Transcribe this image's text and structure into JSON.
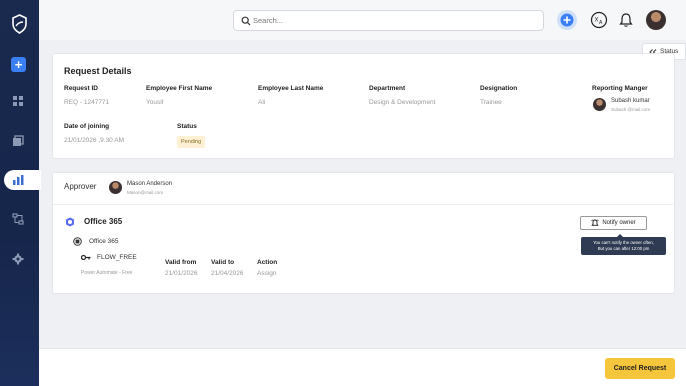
{
  "sidebar": {
    "logo_icon": "shield-logo-icon",
    "add_label": "+",
    "items": [
      {
        "icon": "dashboard-icon"
      },
      {
        "icon": "copy-icon"
      },
      {
        "icon": "chart-icon"
      },
      {
        "icon": "workflow-icon"
      },
      {
        "icon": "gear-icon"
      }
    ]
  },
  "search": {
    "placeholder": "Search..."
  },
  "header_icons": [
    "add-circle-icon",
    "translate-icon",
    "bell-icon",
    "user-avatar"
  ],
  "status_tab": {
    "label": "Status"
  },
  "request": {
    "section_title": "Request Details",
    "fields": {
      "request_id": {
        "label": "Request ID",
        "value": "REQ - 1247771"
      },
      "first_name": {
        "label": "Employee First Name",
        "value": "Yousif"
      },
      "last_name": {
        "label": "Employee Last Name",
        "value": "Ali"
      },
      "department": {
        "label": "Department",
        "value": "Design & Development"
      },
      "designation": {
        "label": "Designation",
        "value": "Trainee"
      },
      "manager": {
        "label": "Reporting Manger",
        "name": "Subash kumar",
        "email": "Subash @mail.com"
      },
      "joining": {
        "label": "Date of joining",
        "value": "21/01/2026 ,9.30 AM"
      },
      "status": {
        "label": "Status",
        "value": "Pending"
      }
    }
  },
  "approver": {
    "label": "Approver",
    "name": "Mason Anderson",
    "email": "Mason@mail.com"
  },
  "license": {
    "product": "Office 365",
    "sub_product": "Office 365",
    "plan": "FLOW_FREE",
    "plan_desc": "Power Automate - Free",
    "columns": {
      "valid_from": "Valid from",
      "valid_to": "Valid to",
      "action": "Action"
    },
    "values": {
      "valid_from": "21/01/2026",
      "valid_to": "21/04/2026",
      "action": "Assign"
    }
  },
  "notify": {
    "label": "Notify owner",
    "tooltip_line1": "You can't notify the owner often,",
    "tooltip_line2": "But you can after 12:00 pm"
  },
  "footer": {
    "cancel_label": "Cancel Request"
  },
  "colors": {
    "sidebar": "#1a2a4f",
    "accent": "#3b7ff5",
    "cancel": "#f5c53b",
    "pending_bg": "#fdf0d5"
  }
}
